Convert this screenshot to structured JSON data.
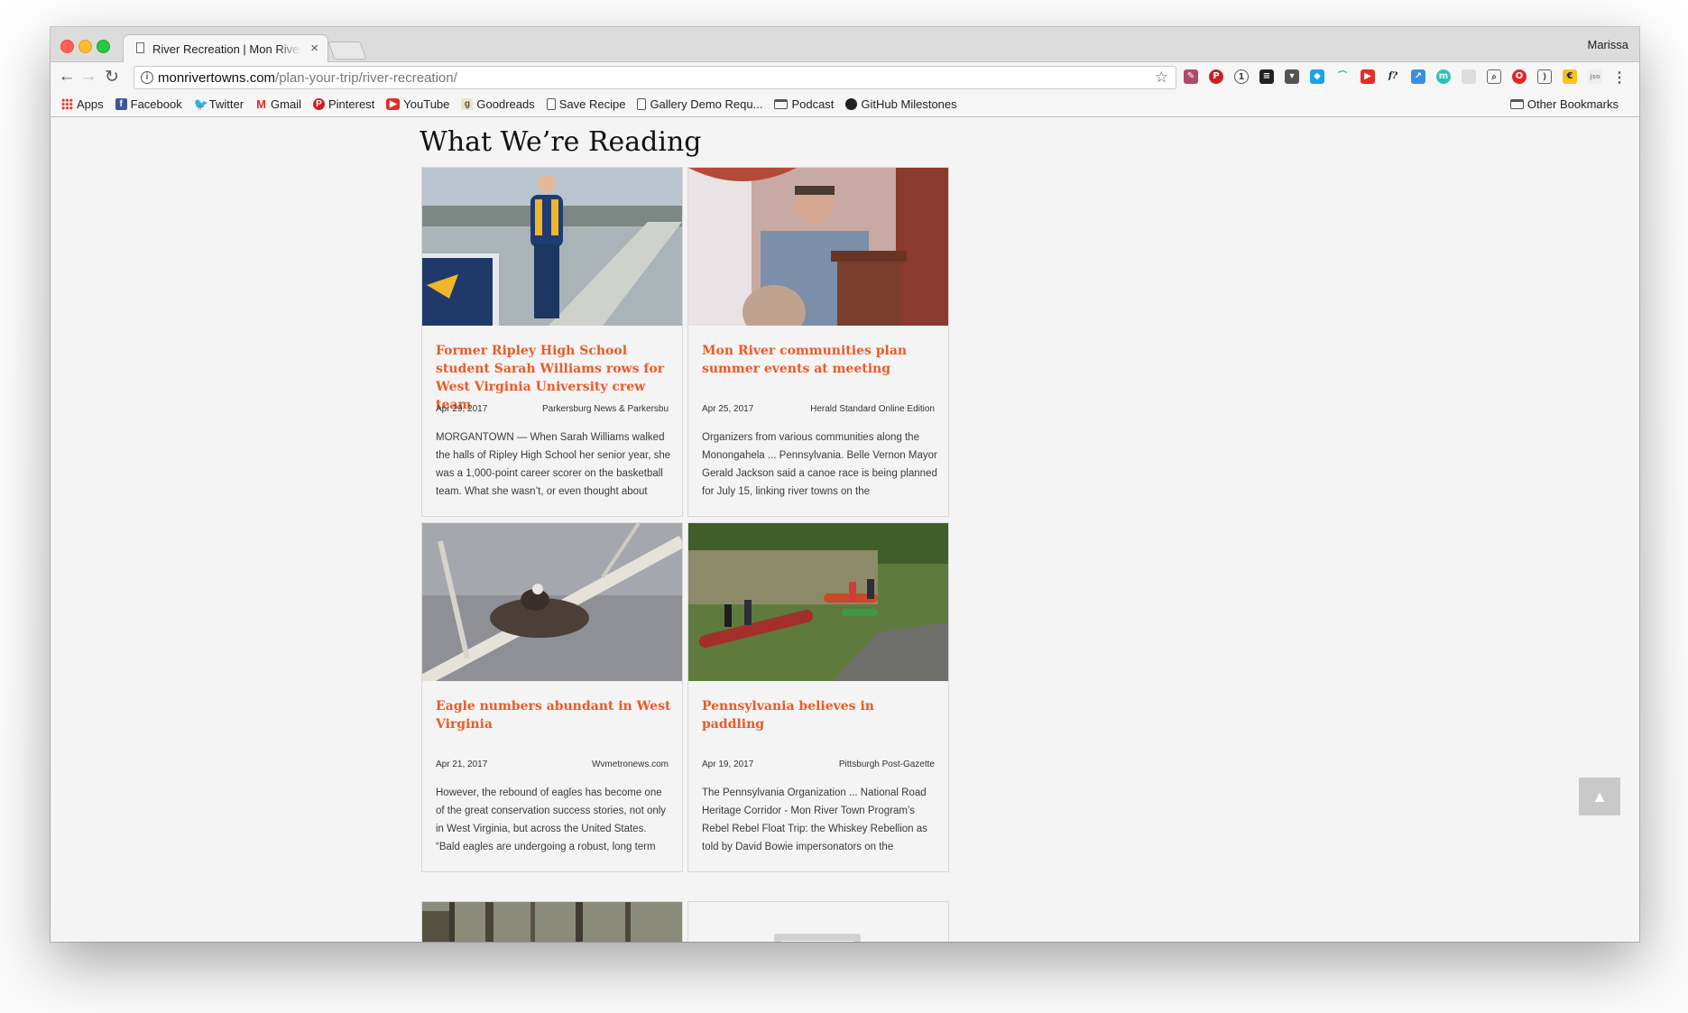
{
  "browser": {
    "tab_title": "River Recreation | Mon River Towns",
    "tab_close": "×",
    "profile_name": "Marissa",
    "url_host": "monrivertowns.com",
    "url_path": "/plan-your-trip/river-recreation/",
    "bookmarks": [
      {
        "label": "Apps",
        "icon": "apps-grid-icon"
      },
      {
        "label": "Facebook",
        "icon": "facebook-icon"
      },
      {
        "label": "Twitter",
        "icon": "twitter-icon"
      },
      {
        "label": "Gmail",
        "icon": "gmail-icon"
      },
      {
        "label": "Pinterest",
        "icon": "pinterest-icon"
      },
      {
        "label": "YouTube",
        "icon": "youtube-icon"
      },
      {
        "label": "Goodreads",
        "icon": "goodreads-icon"
      },
      {
        "label": "Save Recipe",
        "icon": "document-icon"
      },
      {
        "label": "Gallery Demo Requ...",
        "icon": "document-icon"
      },
      {
        "label": "Podcast",
        "icon": "folder-icon"
      },
      {
        "label": "GitHub Milestones",
        "icon": "github-icon"
      }
    ],
    "other_bookmarks": "Other Bookmarks"
  },
  "page": {
    "section_title": "What We’re Reading",
    "scroll_top_icon": "chevron-up-icon"
  },
  "articles": [
    {
      "title": "Former Ripley High School student Sarah Williams rows for West Virginia University crew team",
      "date": "Apr 29, 2017",
      "source": "Parkersburg News & Parkersburg Sentinel",
      "excerpt": "MORGANTOWN — When Sarah Williams walked the halls of Ripley High School her senior year, she was a 1,000-point career scorer on the basketball team. What she wasn’t, or even thought about"
    },
    {
      "title": "Mon River communities plan summer events at meeting",
      "date": "Apr 25, 2017",
      "source": "Herald Standard Online Edition",
      "excerpt": "Organizers from various communities along the Monongahela ... Pennsylvania. Belle Vernon Mayor Gerald Jackson said a canoe race is being planned for July 15, linking river towns on the"
    },
    {
      "title": "Eagle numbers abundant in West Virginia",
      "date": "Apr 21, 2017",
      "source": "Wvmetronews.com",
      "excerpt": "However, the rebound of eagles has become one of the great conservation success stories, not only in West Virginia, but across the United States. “Bald eagles are undergoing a robust, long term"
    },
    {
      "title": "Pennsylvania believes in paddling",
      "date": "Apr 19, 2017",
      "source": "Pittsburgh Post-Gazette",
      "excerpt": "The Pennsylvania Organization ... National Road Heritage Corridor - Mon River Town Program’s Rebel Rebel Float Trip: the Whiskey Rebellion as told by David Bowie impersonators on the"
    }
  ]
}
